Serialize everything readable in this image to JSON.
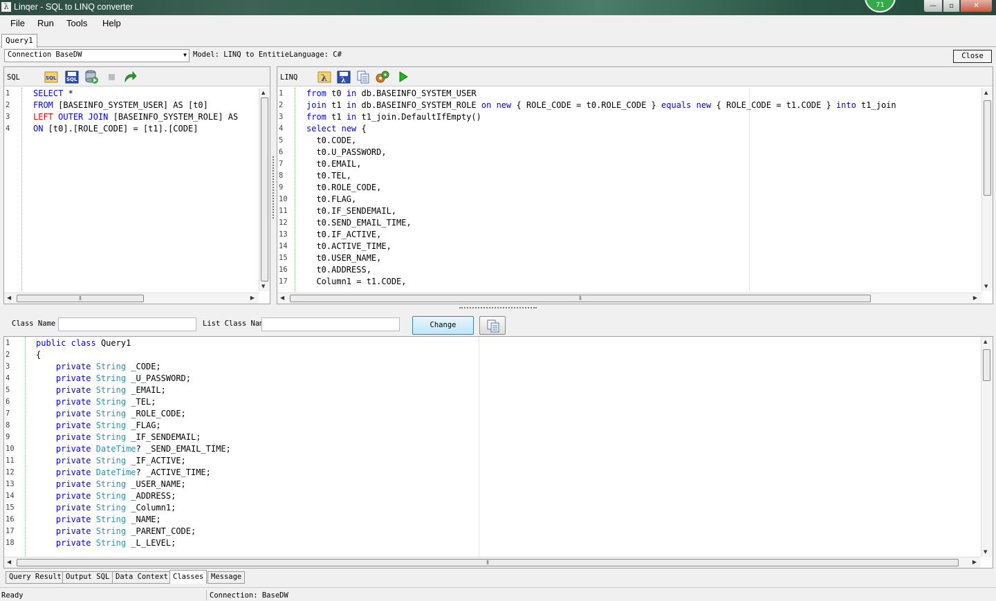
{
  "window": {
    "title": "Linqer - SQL to LINQ converter",
    "badge": "71",
    "min_glyph": "—",
    "max_glyph": "▫",
    "close_glyph": "✕",
    "app_icon": "λ"
  },
  "menu": [
    "File",
    "Run",
    "Tools",
    "Help"
  ],
  "doc_tab": "Query1",
  "connection": {
    "label": "Connection",
    "value": "BaseDW",
    "model_text": "Model: LINQ to EntitieLanguage: C#",
    "close_label": "Close"
  },
  "sql_panel": {
    "label": "SQL",
    "icons": [
      "sql-open-icon",
      "sql-save-icon",
      "database-run-icon",
      "stop-icon",
      "redo-arrow-icon"
    ],
    "line_numbers": [
      "1",
      "2",
      "3",
      "4"
    ],
    "lines": [
      [
        [
          "kw",
          "SELECT"
        ],
        [
          "",
          " *"
        ]
      ],
      [
        [
          "kw",
          "FROM"
        ],
        [
          "",
          " [BASEINFO_SYSTEM_USER] AS [t0]"
        ]
      ],
      [
        [
          "kwr",
          "LEFT"
        ],
        [
          "",
          " "
        ],
        [
          "kw",
          "OUTER JOIN"
        ],
        [
          "",
          " [BASEINFO_SYSTEM_ROLE] AS"
        ]
      ],
      [
        [
          "kw",
          "ON"
        ],
        [
          "",
          " [t0].[ROLE_CODE] = [t1].[CODE]"
        ]
      ]
    ]
  },
  "linq_panel": {
    "label": "LINQ",
    "icons": [
      "lambda-open-icon",
      "lambda-save-icon",
      "copy-icon",
      "settings-gear-icon",
      "run-play-icon"
    ],
    "line_numbers": [
      "1",
      "2",
      "3",
      "4",
      "5",
      "6",
      "7",
      "8",
      "9",
      "10",
      "11",
      "12",
      "13",
      "14",
      "15",
      "16",
      "17"
    ],
    "lines": [
      [
        [
          "kw",
          "from"
        ],
        [
          "",
          " t0 "
        ],
        [
          "kw",
          "in"
        ],
        [
          "",
          " db.BASEINFO_SYSTEM_USER"
        ]
      ],
      [
        [
          "kw",
          "join"
        ],
        [
          "",
          " t1 "
        ],
        [
          "kw",
          "in"
        ],
        [
          "",
          " db.BASEINFO_SYSTEM_ROLE "
        ],
        [
          "kw",
          "on"
        ],
        [
          "",
          " "
        ],
        [
          "kw",
          "new"
        ],
        [
          "",
          " { ROLE_CODE = t0.ROLE_CODE } "
        ],
        [
          "kw",
          "equals"
        ],
        [
          "",
          " "
        ],
        [
          "kw",
          "new"
        ],
        [
          "",
          " { ROLE_CODE = t1.CODE } "
        ],
        [
          "kw",
          "into"
        ],
        [
          "",
          " t1_join"
        ]
      ],
      [
        [
          "kw",
          "from"
        ],
        [
          "",
          " t1 "
        ],
        [
          "kw",
          "in"
        ],
        [
          "",
          " t1_join.DefaultIfEmpty()"
        ]
      ],
      [
        [
          "kw",
          "select"
        ],
        [
          "",
          " "
        ],
        [
          "kw",
          "new"
        ],
        [
          "",
          " {"
        ]
      ],
      [
        [
          "",
          "  t0.CODE,"
        ]
      ],
      [
        [
          "",
          "  t0.U_PASSWORD,"
        ]
      ],
      [
        [
          "",
          "  t0.EMAIL,"
        ]
      ],
      [
        [
          "",
          "  t0.TEL,"
        ]
      ],
      [
        [
          "",
          "  t0.ROLE_CODE,"
        ]
      ],
      [
        [
          "",
          "  t0.FLAG,"
        ]
      ],
      [
        [
          "",
          "  t0.IF_SENDEMAIL,"
        ]
      ],
      [
        [
          "",
          "  t0.SEND_EMAIL_TIME,"
        ]
      ],
      [
        [
          "",
          "  t0.IF_ACTIVE,"
        ]
      ],
      [
        [
          "",
          "  t0.ACTIVE_TIME,"
        ]
      ],
      [
        [
          "",
          "  t0.USER_NAME,"
        ]
      ],
      [
        [
          "",
          "  t0.ADDRESS,"
        ]
      ],
      [
        [
          "",
          "  Column1 = t1.CODE,"
        ]
      ]
    ]
  },
  "class_row": {
    "class_name_label": "Class Name",
    "class_name_value": "",
    "list_class_label": "List Class Nam",
    "list_class_value": "",
    "change_label": "Change"
  },
  "classes_code": {
    "line_numbers": [
      "1",
      "2",
      "3",
      "4",
      "5",
      "6",
      "7",
      "8",
      "9",
      "10",
      "11",
      "12",
      "13",
      "14",
      "15",
      "16",
      "17",
      "18"
    ],
    "lines": [
      [
        [
          "kw",
          "public"
        ],
        [
          "",
          " "
        ],
        [
          "kw",
          "class"
        ],
        [
          "",
          " Query1"
        ]
      ],
      [
        [
          "",
          "{"
        ]
      ],
      [
        [
          "",
          "    "
        ],
        [
          "kw",
          "private"
        ],
        [
          "",
          " "
        ],
        [
          "typ",
          "String"
        ],
        [
          "",
          " _CODE;"
        ]
      ],
      [
        [
          "",
          "    "
        ],
        [
          "kw",
          "private"
        ],
        [
          "",
          " "
        ],
        [
          "typ",
          "String"
        ],
        [
          "",
          " _U_PASSWORD;"
        ]
      ],
      [
        [
          "",
          "    "
        ],
        [
          "kw",
          "private"
        ],
        [
          "",
          " "
        ],
        [
          "typ",
          "String"
        ],
        [
          "",
          " _EMAIL;"
        ]
      ],
      [
        [
          "",
          "    "
        ],
        [
          "kw",
          "private"
        ],
        [
          "",
          " "
        ],
        [
          "typ",
          "String"
        ],
        [
          "",
          " _TEL;"
        ]
      ],
      [
        [
          "",
          "    "
        ],
        [
          "kw",
          "private"
        ],
        [
          "",
          " "
        ],
        [
          "typ",
          "String"
        ],
        [
          "",
          " _ROLE_CODE;"
        ]
      ],
      [
        [
          "",
          "    "
        ],
        [
          "kw",
          "private"
        ],
        [
          "",
          " "
        ],
        [
          "typ",
          "String"
        ],
        [
          "",
          " _FLAG;"
        ]
      ],
      [
        [
          "",
          "    "
        ],
        [
          "kw",
          "private"
        ],
        [
          "",
          " "
        ],
        [
          "typ",
          "String"
        ],
        [
          "",
          " _IF_SENDEMAIL;"
        ]
      ],
      [
        [
          "",
          "    "
        ],
        [
          "kw",
          "private"
        ],
        [
          "",
          " "
        ],
        [
          "typ",
          "DateTime"
        ],
        [
          "",
          "? _SEND_EMAIL_TIME;"
        ]
      ],
      [
        [
          "",
          "    "
        ],
        [
          "kw",
          "private"
        ],
        [
          "",
          " "
        ],
        [
          "typ",
          "String"
        ],
        [
          "",
          " _IF_ACTIVE;"
        ]
      ],
      [
        [
          "",
          "    "
        ],
        [
          "kw",
          "private"
        ],
        [
          "",
          " "
        ],
        [
          "typ",
          "DateTime"
        ],
        [
          "",
          "? _ACTIVE_TIME;"
        ]
      ],
      [
        [
          "",
          "    "
        ],
        [
          "kw",
          "private"
        ],
        [
          "",
          " "
        ],
        [
          "typ",
          "String"
        ],
        [
          "",
          " _USER_NAME;"
        ]
      ],
      [
        [
          "",
          "    "
        ],
        [
          "kw",
          "private"
        ],
        [
          "",
          " "
        ],
        [
          "typ",
          "String"
        ],
        [
          "",
          " _ADDRESS;"
        ]
      ],
      [
        [
          "",
          "    "
        ],
        [
          "kw",
          "private"
        ],
        [
          "",
          " "
        ],
        [
          "typ",
          "String"
        ],
        [
          "",
          " _Column1;"
        ]
      ],
      [
        [
          "",
          "    "
        ],
        [
          "kw",
          "private"
        ],
        [
          "",
          " "
        ],
        [
          "typ",
          "String"
        ],
        [
          "",
          " _NAME;"
        ]
      ],
      [
        [
          "",
          "    "
        ],
        [
          "kw",
          "private"
        ],
        [
          "",
          " "
        ],
        [
          "typ",
          "String"
        ],
        [
          "",
          " _PARENT_CODE;"
        ]
      ],
      [
        [
          "",
          "    "
        ],
        [
          "kw",
          "private"
        ],
        [
          "",
          " "
        ],
        [
          "typ",
          "String"
        ],
        [
          "",
          " _L_LEVEL;"
        ]
      ]
    ]
  },
  "bottom_tabs": [
    "Query Result",
    "Output SQL",
    "Data Context",
    "Classes",
    "Message"
  ],
  "active_bottom_tab": "Classes",
  "status": {
    "left": "Ready",
    "connection": "Connection: BaseDW"
  },
  "colors": {
    "keyword": "#0000ff",
    "keyword_red": "#ff0000",
    "type": "#2b91af"
  }
}
